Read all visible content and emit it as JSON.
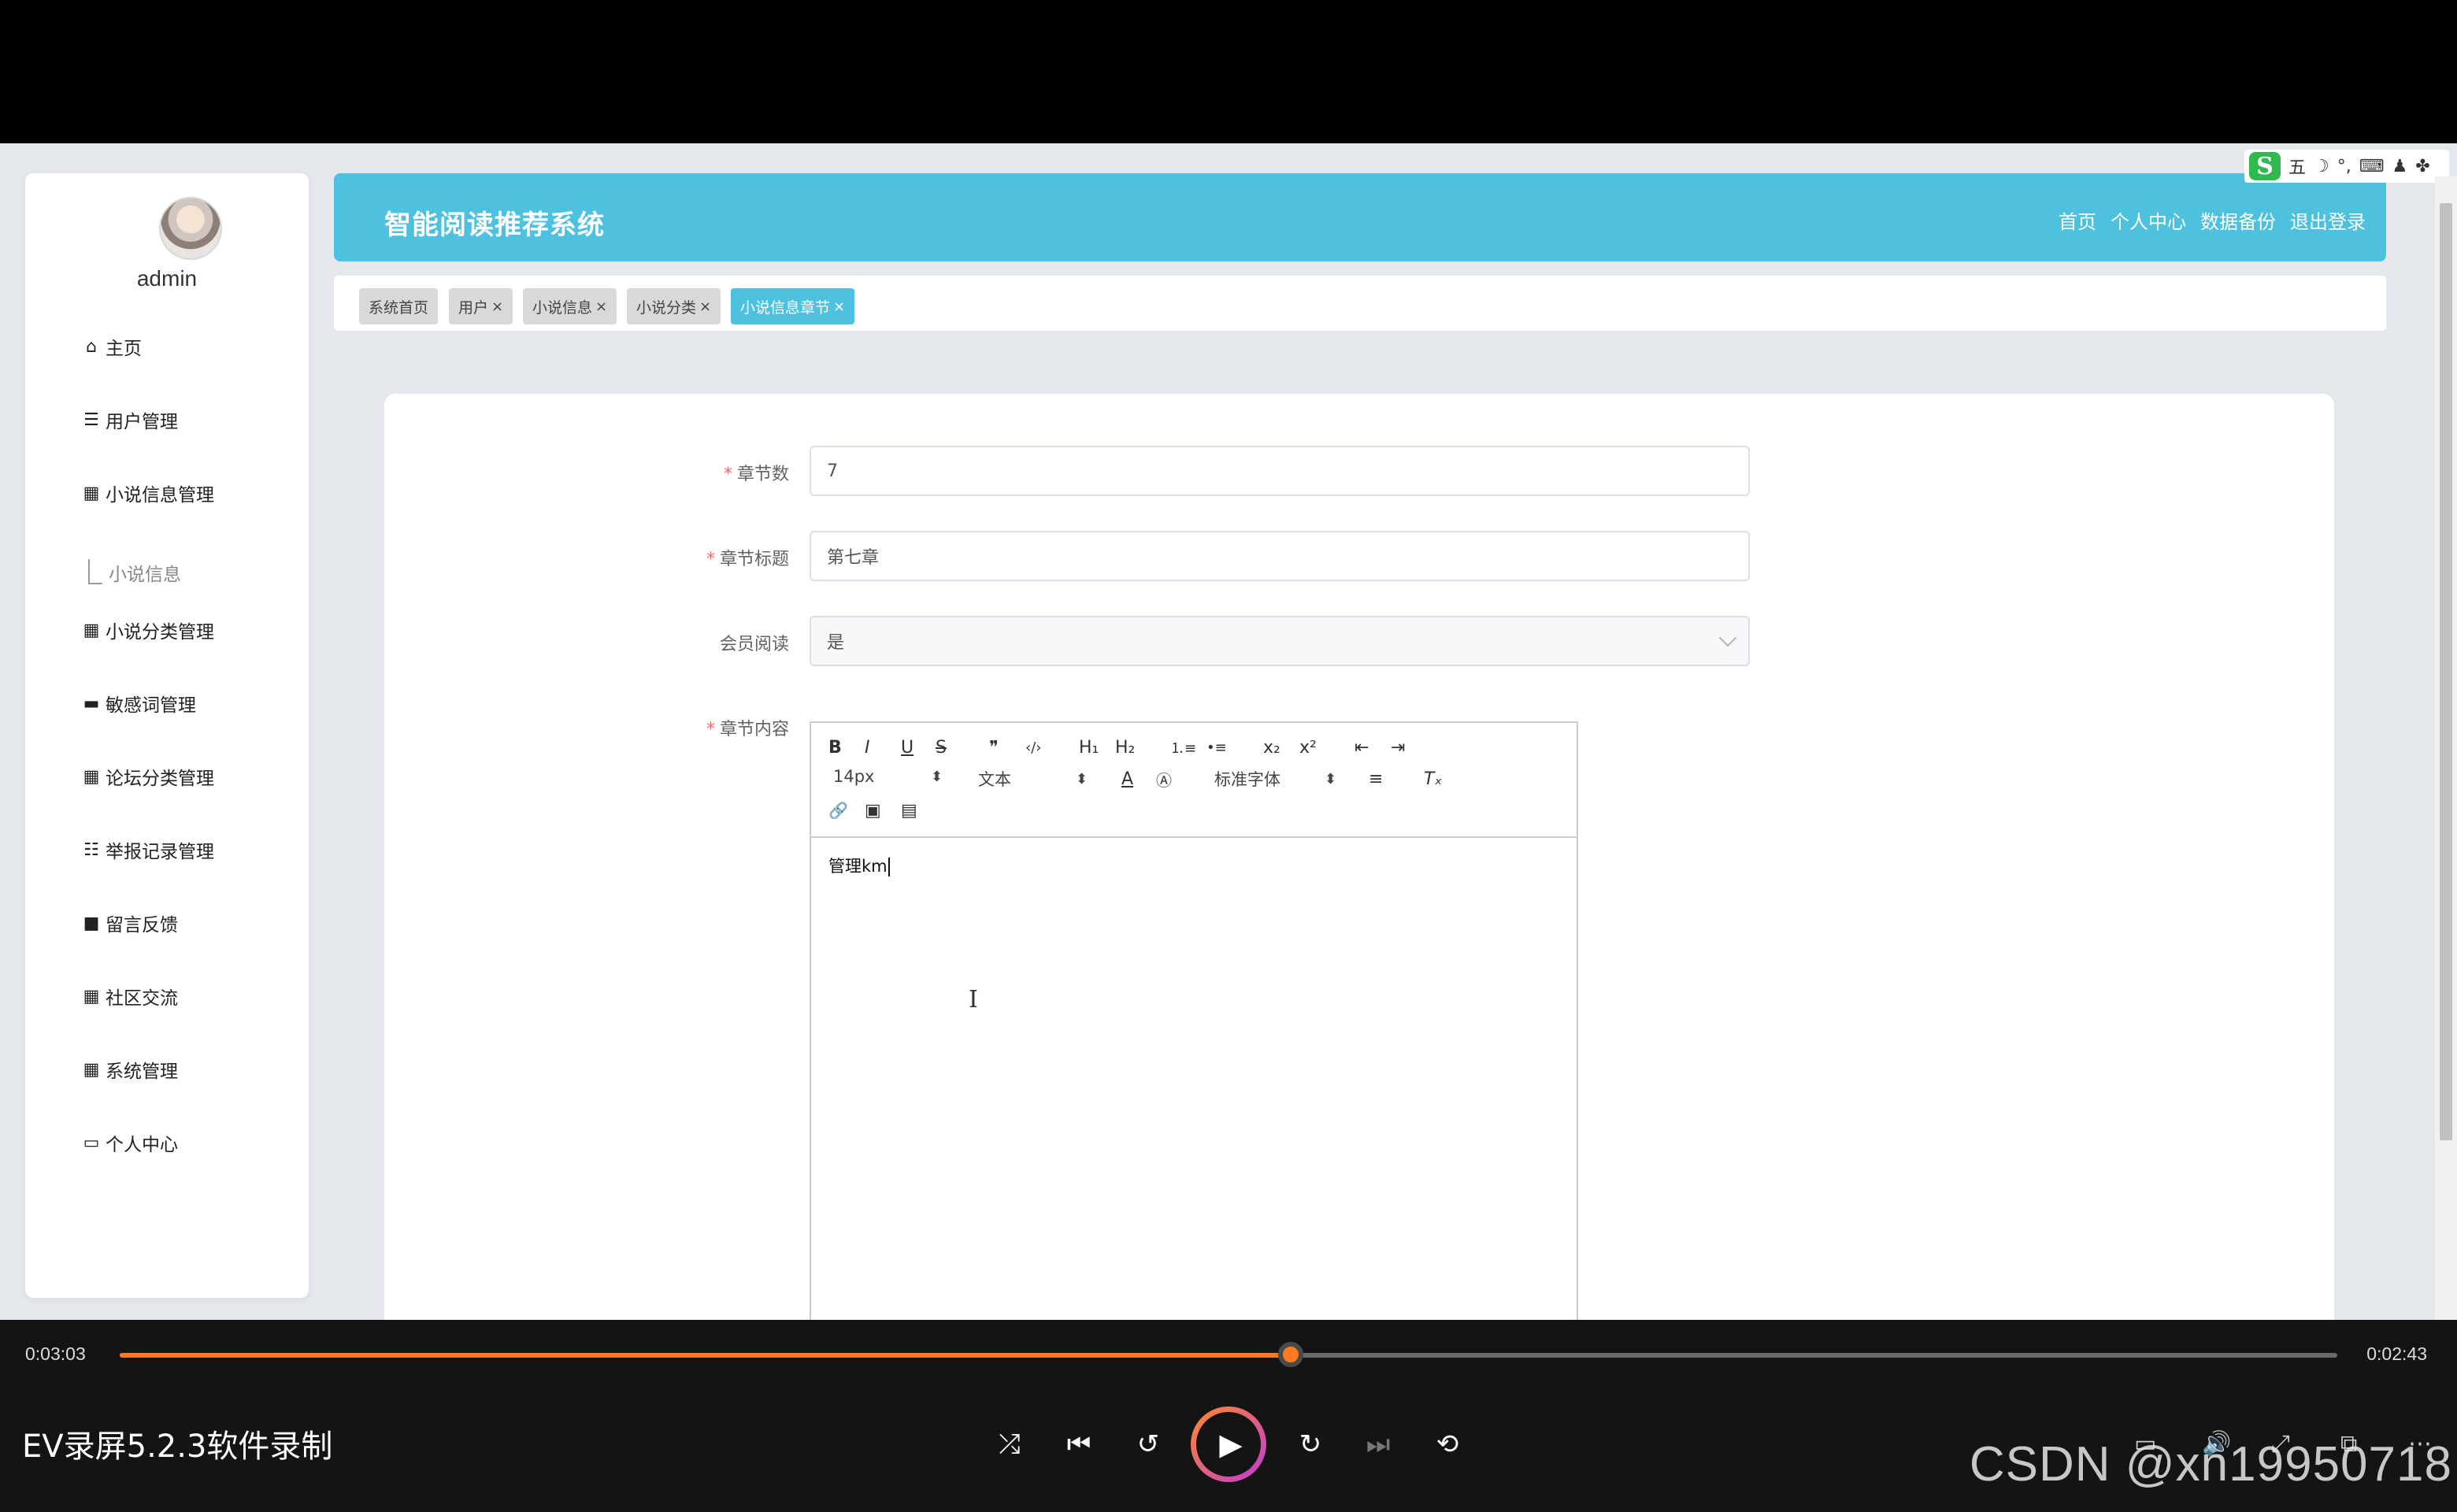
{
  "sidebar": {
    "username": "admin",
    "items": [
      {
        "label": "主页",
        "icon": "home-icon",
        "glyph": "⌂"
      },
      {
        "label": "用户管理",
        "icon": "list-icon",
        "glyph": "☰"
      },
      {
        "label": "小说信息管理",
        "icon": "grid-icon",
        "glyph": "▦"
      },
      {
        "label": "小说分类管理",
        "icon": "grid-icon",
        "glyph": "▦"
      },
      {
        "label": "敏感词管理",
        "icon": "comment-icon",
        "glyph": "▬"
      },
      {
        "label": "论坛分类管理",
        "icon": "grid-icon",
        "glyph": "▦"
      },
      {
        "label": "举报记录管理",
        "icon": "sliders-icon",
        "glyph": "☷"
      },
      {
        "label": "留言反馈",
        "icon": "monitor-icon",
        "glyph": "■"
      },
      {
        "label": "社区交流",
        "icon": "grid-icon",
        "glyph": "▦"
      },
      {
        "label": "系统管理",
        "icon": "grid-icon",
        "glyph": "▦"
      },
      {
        "label": "个人中心",
        "icon": "card-icon",
        "glyph": "▭"
      }
    ],
    "sub_item": "小说信息"
  },
  "header": {
    "title": "智能阅读推荐系统",
    "nav": [
      "首页",
      "个人中心",
      "数据备份",
      "退出登录"
    ]
  },
  "ime": {
    "logo": "S",
    "mode": "五",
    "moon": "☽",
    "punct": "°,",
    "keyboard": "⌨",
    "user": "♟",
    "more": "✤"
  },
  "tabs": [
    {
      "label": "系统首页",
      "closable": false
    },
    {
      "label": "用户",
      "closable": true
    },
    {
      "label": "小说信息",
      "closable": true
    },
    {
      "label": "小说分类",
      "closable": true
    },
    {
      "label": "小说信息章节",
      "closable": true,
      "active": true
    }
  ],
  "tab_close": "×",
  "form": {
    "chapter_num": {
      "label": "章节数",
      "required": true,
      "value": "7"
    },
    "chapter_title": {
      "label": "章节标题",
      "required": true,
      "value": "第七章"
    },
    "member_read": {
      "label": "会员阅读",
      "required": false,
      "value": "是"
    },
    "chapter_content": {
      "label": "章节内容",
      "required": true,
      "value": "管理km"
    },
    "required_mark": "*"
  },
  "editor": {
    "buttons": {
      "bold": "B",
      "italic": "I",
      "underline": "U",
      "strike": "S",
      "quote": "❞",
      "code": "‹/›",
      "h1": "H₁",
      "h2": "H₂",
      "ordered_list": "⒈≡",
      "bullet_list": "•≡",
      "sub": "x₂",
      "sup": "x²",
      "outdent": "⇤",
      "indent": "⇥",
      "color": "A",
      "background": "Ⓐ",
      "align": "≡",
      "clean": "Tₓ",
      "link": "🔗",
      "image": "▣",
      "video": "▤"
    },
    "size": "14px",
    "header_select": "文本",
    "font_select": "标准字体",
    "updown": "⬍"
  },
  "player": {
    "elapsed": "0:03:03",
    "remaining": "0:02:43",
    "progress": 0.528,
    "app_title": "EV录屏5.2.3软件录制",
    "controls": {
      "shuffle": "⤮",
      "prev": "⏮",
      "back10": "↺",
      "play": "▶",
      "fwd30": "↻",
      "next": "⏭",
      "repeat": "⟲"
    },
    "right_controls": {
      "subtitle": "▭",
      "volume": "🔊",
      "expand": "⤢",
      "pip": "⧉",
      "more": "⋯"
    },
    "watermark": "CSDN @xn19950718",
    "accent": "#ff7a21"
  },
  "colors": {
    "header": "#4ec1df",
    "required": "#f56c6c"
  }
}
